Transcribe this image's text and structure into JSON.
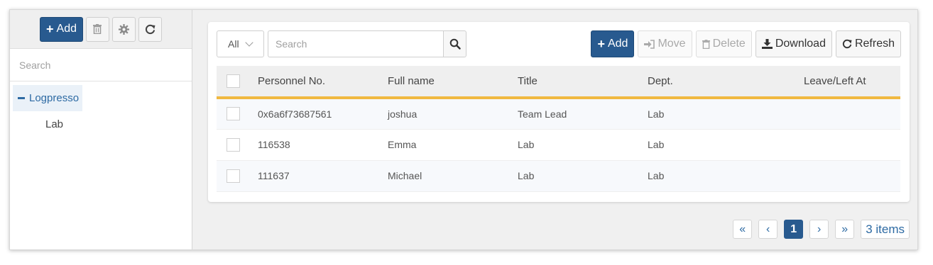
{
  "sidebar": {
    "add_label": "Add",
    "search_placeholder": "Search",
    "tree": {
      "root": "Logpresso",
      "children": [
        "Lab"
      ]
    },
    "icons": [
      "plus-icon",
      "trash-icon",
      "gear-icon",
      "refresh-icon"
    ]
  },
  "toolbar": {
    "filter_value": "All",
    "search_placeholder": "Search",
    "add_label": "Add",
    "move_label": "Move",
    "delete_label": "Delete",
    "download_label": "Download",
    "refresh_label": "Refresh"
  },
  "table": {
    "columns": [
      "Personnel No.",
      "Full name",
      "Title",
      "Dept.",
      "Leave/Left At"
    ],
    "rows": [
      [
        "0x6a6f73687561",
        "joshua",
        "Team Lead",
        "Lab",
        ""
      ],
      [
        "116538",
        "Emma",
        "Lab",
        "Lab",
        ""
      ],
      [
        "111637",
        "Michael",
        "Lab",
        "Lab",
        ""
      ]
    ]
  },
  "pager": {
    "current_page": "1",
    "count_label": "3 items"
  },
  "colors": {
    "primary": "#285a8f",
    "header_underline": "#f0b840",
    "tree_selected_bg": "#eaf1f8"
  }
}
